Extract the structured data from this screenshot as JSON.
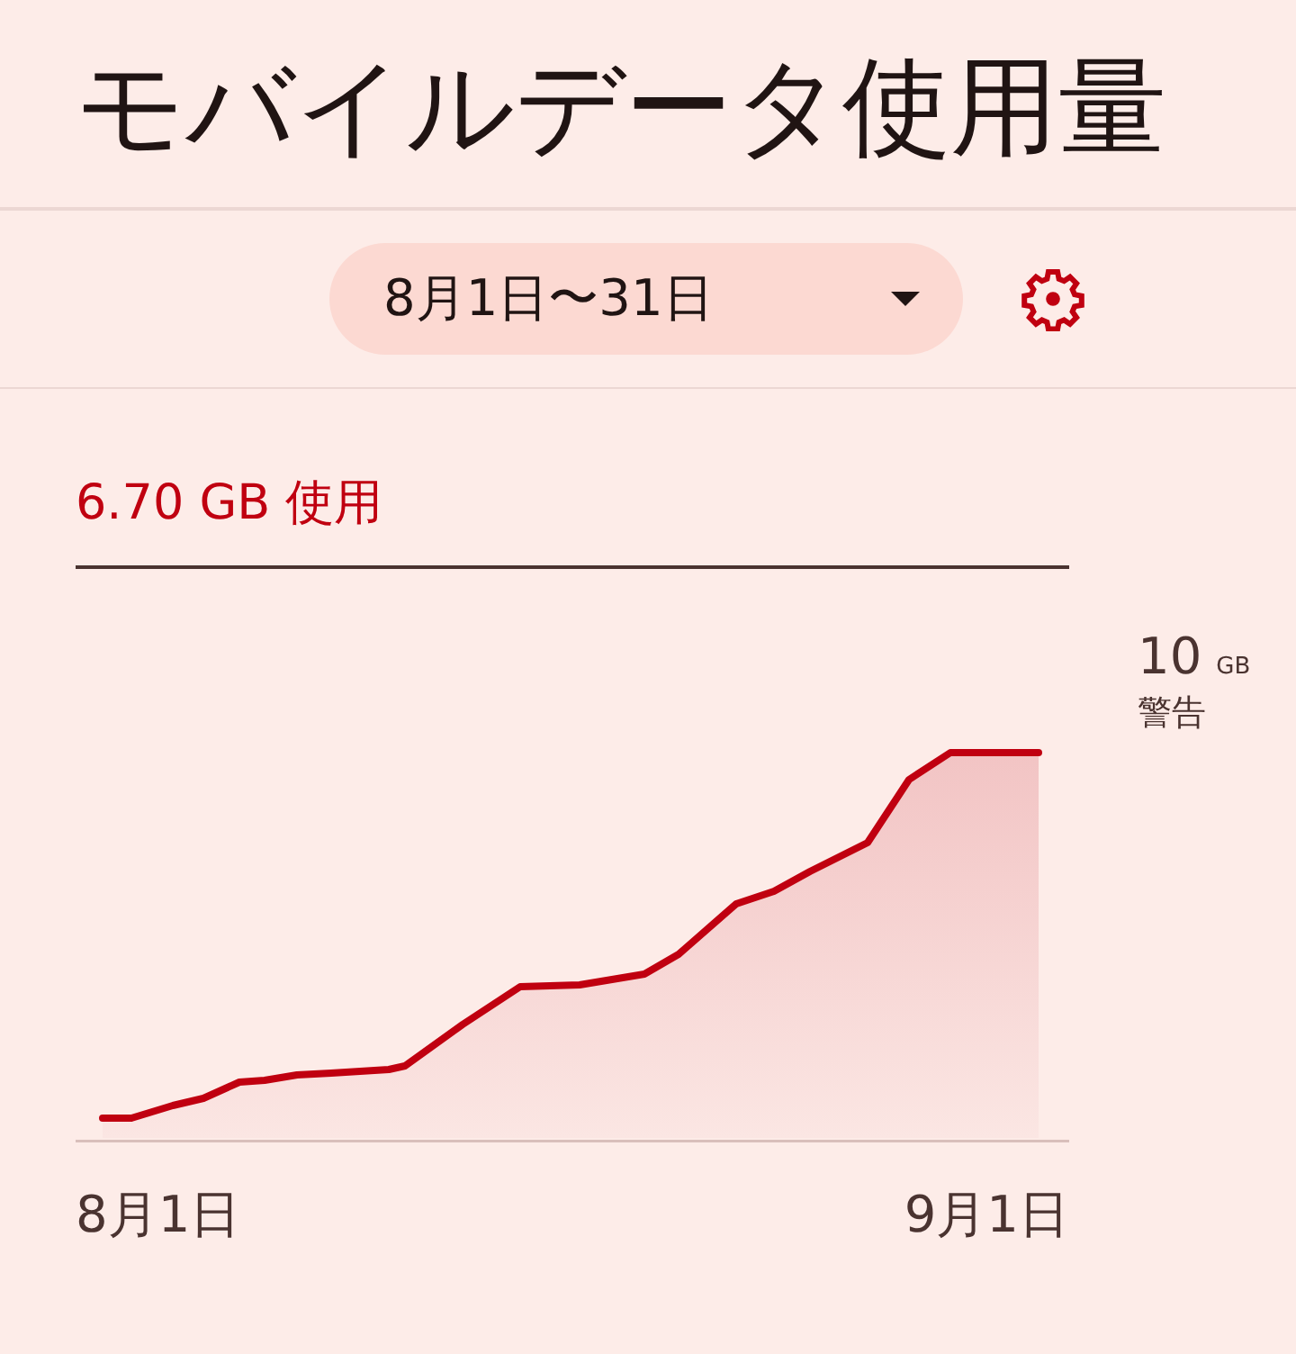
{
  "title": "モバイルデータ使用量",
  "date_range": {
    "label": "8月1日〜31日"
  },
  "usage": "6.70 GB 使用",
  "warning": {
    "value": "10",
    "unit": "GB",
    "label": "警告"
  },
  "x_labels": [
    "8月1日",
    "9月1日"
  ]
}
